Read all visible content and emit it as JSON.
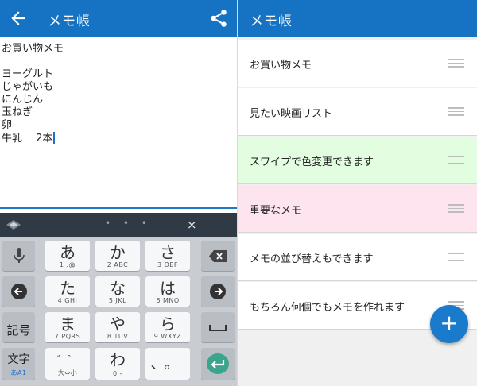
{
  "left": {
    "appbar": {
      "title": "メモ帳",
      "back_icon": "arrow-left-icon",
      "share_icon": "share-icon",
      "color": "#1673c4"
    },
    "editor": {
      "lines": [
        "お買い物メモ",
        "",
        "ヨーグルト",
        "じゃがいも",
        "にんじん",
        "玉ねぎ",
        "卵",
        "牛乳　 2本"
      ]
    },
    "keyboard": {
      "dots": "• • •",
      "close": "×",
      "keys": {
        "a": {
          "main": "あ",
          "sub": "1 .@"
        },
        "ka": {
          "main": "か",
          "sub": "2 ABC"
        },
        "sa": {
          "main": "さ",
          "sub": "3 DEF"
        },
        "ta": {
          "main": "た",
          "sub": "4 GHI"
        },
        "na": {
          "main": "な",
          "sub": "5 JKL"
        },
        "ha": {
          "main": "は",
          "sub": "6 MNO"
        },
        "ma": {
          "main": "ま",
          "sub": "7 PQRS"
        },
        "ya": {
          "main": "や",
          "sub": "8 TUV"
        },
        "ra": {
          "main": "ら",
          "sub": "9 WXYZ"
        },
        "dakuten": {
          "main": "゛゜",
          "sub": "大⇔小"
        },
        "wa": {
          "main": "わ",
          "sub": "0 -"
        },
        "punct": {
          "main": "、。"
        },
        "symbols": {
          "label": "記号"
        },
        "mode": {
          "label": "文字",
          "sub": "あA1"
        }
      }
    }
  },
  "right": {
    "appbar": {
      "title": "メモ帳"
    },
    "memos": [
      {
        "label": "お買い物メモ",
        "bg": "#ffffff"
      },
      {
        "label": "見たい映画リスト",
        "bg": "#ffffff"
      },
      {
        "label": "スワイプで色変更できます",
        "bg": "#e3fde0"
      },
      {
        "label": "重要なメモ",
        "bg": "#fde4ef"
      },
      {
        "label": "メモの並び替えもできます",
        "bg": "#ffffff"
      },
      {
        "label": "もちろん何個でもメモを作れます",
        "bg": "#ffffff"
      }
    ],
    "fab": {
      "label": "+",
      "icon": "plus-icon"
    }
  }
}
